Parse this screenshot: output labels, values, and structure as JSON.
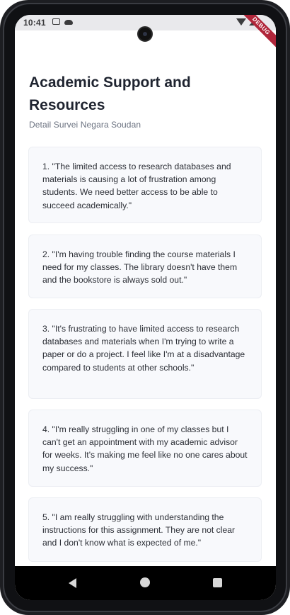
{
  "status_bar": {
    "time": "10:41"
  },
  "debug_banner": "DEBUG",
  "header": {
    "title": "Academic Support and Resources",
    "subtitle": "Detail Survei Negara Soudan"
  },
  "responses": [
    {
      "text": "1. \"The limited access to research databases and materials is causing a lot of frustration among students. We need better access to be able to succeed academically.\""
    },
    {
      "text": "2. \"I'm having trouble finding the course materials I need for my classes. The library doesn't have them and the bookstore is always sold out.\""
    },
    {
      "text": "3. \"It's frustrating to have limited access to research databases and materials when I'm trying to write a paper or do a project. I feel like I'm at a disadvantage compared to students at other schools.\""
    },
    {
      "text": "4. \"I'm really struggling in one of my classes but I can't get an appointment with my academic advisor for weeks. It's making me feel like no one cares about my success.\""
    },
    {
      "text": "5. \"I am really struggling with understanding the instructions for this assignment. They are not clear and I don't know what is expected of me.\""
    }
  ],
  "icons": {
    "nav_back": "back-triangle-icon",
    "nav_home": "home-circle-icon",
    "nav_recents": "recents-square-icon"
  }
}
